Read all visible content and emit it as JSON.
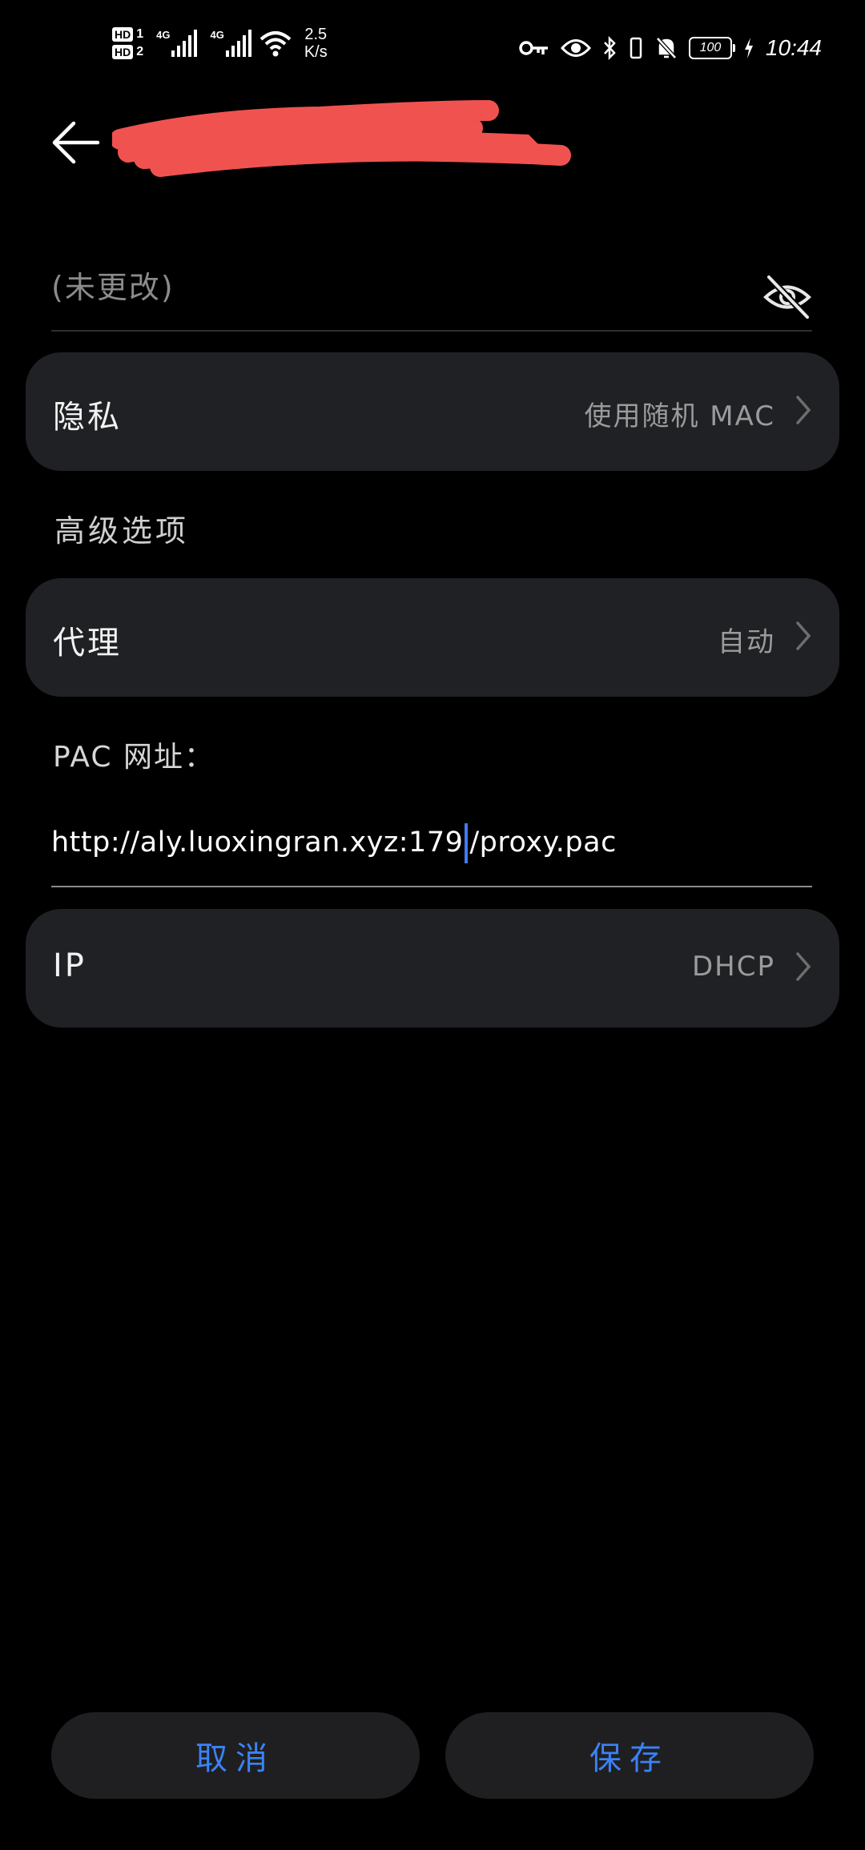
{
  "status_bar": {
    "sim1_label": "HD",
    "sim1_num": "1",
    "sim2_label": "HD",
    "sim2_num": "2",
    "network1": "4G",
    "network2": "4G",
    "speed_value": "2.5",
    "speed_unit": "K/s",
    "battery": "100",
    "time": "10:44",
    "icons": [
      "key-icon",
      "eye-icon",
      "bluetooth-icon",
      "vibrate-icon",
      "bell-off-icon",
      "charging-icon"
    ]
  },
  "header": {
    "back_icon": "arrow-left-icon",
    "redaction_color": "#f0534f"
  },
  "password": {
    "placeholder": "(未更改)",
    "toggle_icon": "eye-off-icon"
  },
  "privacy_row": {
    "label": "隐私",
    "value": "使用随机 MAC"
  },
  "advanced_heading": "高级选项",
  "proxy_row": {
    "label": "代理",
    "value": "自动"
  },
  "pac": {
    "label": "PAC 网址：",
    "value_before_cursor": "http://aly.luoxingran.xyz:179",
    "value_after_cursor": "/proxy.pac"
  },
  "ip_row": {
    "label": "IP",
    "value": "DHCP"
  },
  "actions": {
    "cancel": "取消",
    "save": "保存"
  },
  "colors": {
    "accent": "#3b82f6",
    "card": "#202124",
    "background": "#000000"
  }
}
